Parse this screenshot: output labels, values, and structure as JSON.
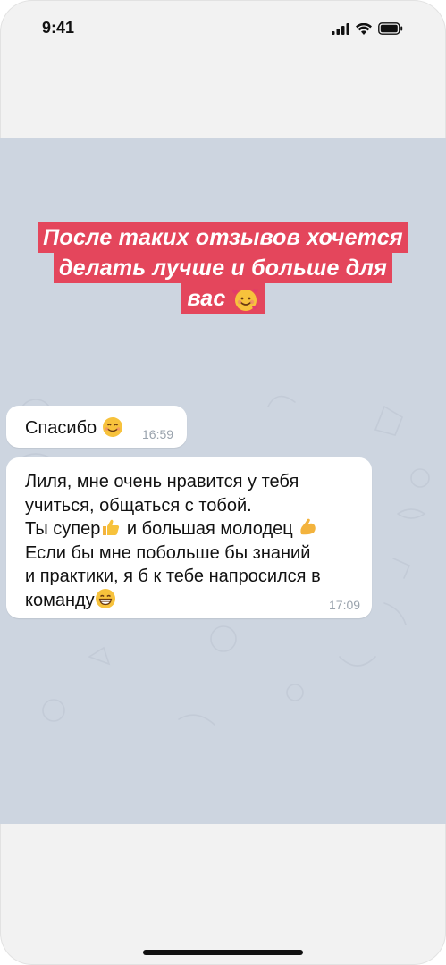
{
  "status_bar": {
    "time": "9:41"
  },
  "story": {
    "caption_lines": [
      "После таких отзывов хочется",
      "делать лучше и больше для",
      "вас"
    ],
    "caption_emoji": "smiling-face-with-hearts-icon",
    "background_color": "#cdd5e0",
    "caption_bg_color": "#e4465c"
  },
  "messages": [
    {
      "text": "Спасибо",
      "emoji": "smiling-face-icon",
      "time": "16:59"
    },
    {
      "lines": [
        "Лиля, мне очень нравится у тебя",
        "учиться, общаться с тобой.",
        "Ты супер",
        "и большая молодец",
        "Если бы мне побольше бы знаний",
        "и практики, я б к тебе напросился в",
        "команду"
      ],
      "emojis": [
        "thumbs-up-icon",
        "flexed-biceps-icon",
        "grinning-face-icon"
      ],
      "time": "17:09"
    }
  ]
}
